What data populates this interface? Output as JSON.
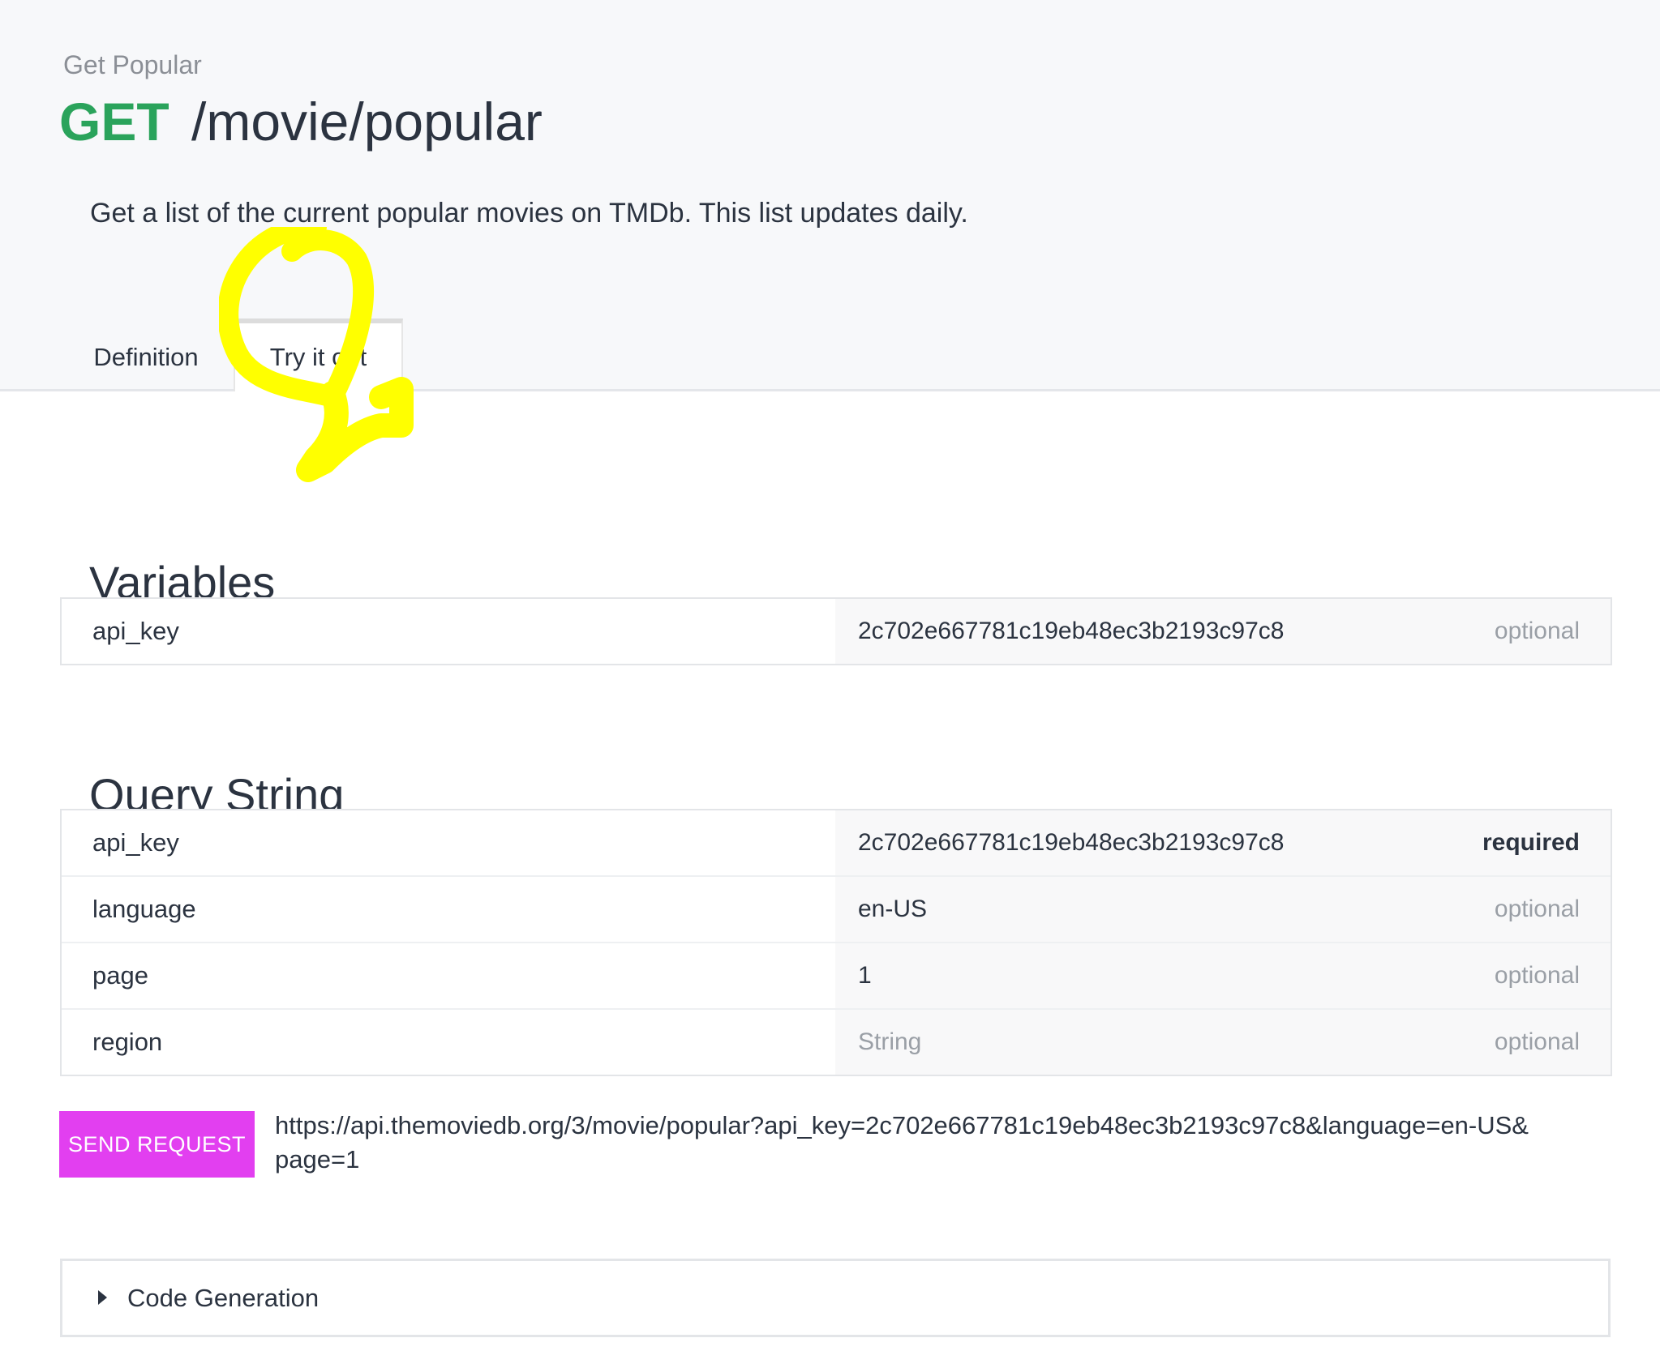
{
  "header": {
    "operation_name": "Get Popular",
    "method": "GET",
    "path": "/movie/popular",
    "description": "Get a list of the current popular movies on TMDb. This list updates daily."
  },
  "tabs": [
    {
      "label": "Definition",
      "active": false
    },
    {
      "label": "Try it out",
      "active": true
    }
  ],
  "variables": {
    "title": "Variables",
    "rows": [
      {
        "name": "api_key",
        "value": "2c702e667781c19eb48ec3b2193c97c8",
        "placeholder": "",
        "requirement": "optional"
      }
    ]
  },
  "query_string": {
    "title": "Query String",
    "rows": [
      {
        "name": "api_key",
        "value": "2c702e667781c19eb48ec3b2193c97c8",
        "placeholder": "",
        "requirement": "required"
      },
      {
        "name": "language",
        "value": "en-US",
        "placeholder": "",
        "requirement": "optional"
      },
      {
        "name": "page",
        "value": "1",
        "placeholder": "",
        "requirement": "optional"
      },
      {
        "name": "region",
        "value": "",
        "placeholder": "String",
        "requirement": "optional"
      }
    ]
  },
  "request": {
    "send_label": "SEND REQUEST",
    "url": "https://api.themoviedb.org/3/movie/popular?api_key=2c702e667781c19eb48ec3b2193c97c8&language=en-US&page=1"
  },
  "code_generation": {
    "label": "Code Generation",
    "icon": "caret-right-icon"
  },
  "colors": {
    "method_get": "#2aa35b",
    "send_button": "#e23ff0",
    "highlight_annotation": "#ffff00"
  }
}
